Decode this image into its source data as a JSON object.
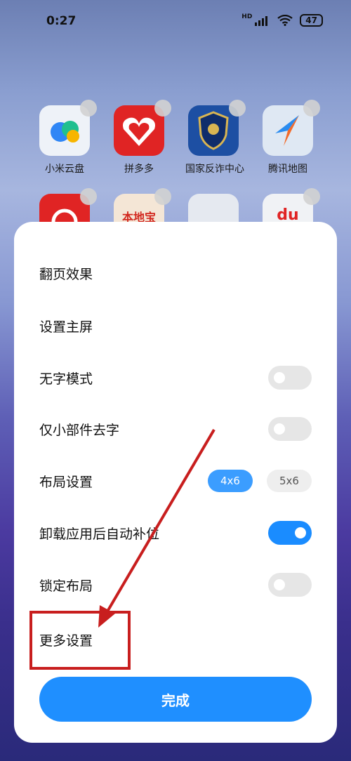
{
  "status": {
    "time": "0:27",
    "hd": "HD",
    "battery": "47"
  },
  "apps": [
    {
      "name": "小米云盘",
      "color": "#e9eef6"
    },
    {
      "name": "拼多多",
      "color": "#e02424"
    },
    {
      "name": "国家反诈中心",
      "color": "#1d4fa3"
    },
    {
      "name": "腾讯地图",
      "color": "#dfe8f3"
    },
    {
      "name": "",
      "color": "#e02424"
    },
    {
      "name": "",
      "color": "#f4e6d6",
      "text": "本地宝"
    },
    {
      "name": "",
      "color": "#e5e9f0"
    },
    {
      "name": "",
      "color": "#f0f2f5",
      "text": "du"
    }
  ],
  "settings": {
    "page_effect": "翻页效果",
    "home_screen": "设置主屏",
    "no_text_mode": "无字模式",
    "widgets_no_text": "仅小部件去字",
    "layout": "布局设置",
    "layout_options": [
      "4x6",
      "5x6"
    ],
    "auto_fill": "卸载应用后自动补位",
    "lock_layout": "锁定布局",
    "more_settings": "更多设置",
    "done": "完成"
  },
  "annotation": {
    "color": "#c81e1e"
  }
}
